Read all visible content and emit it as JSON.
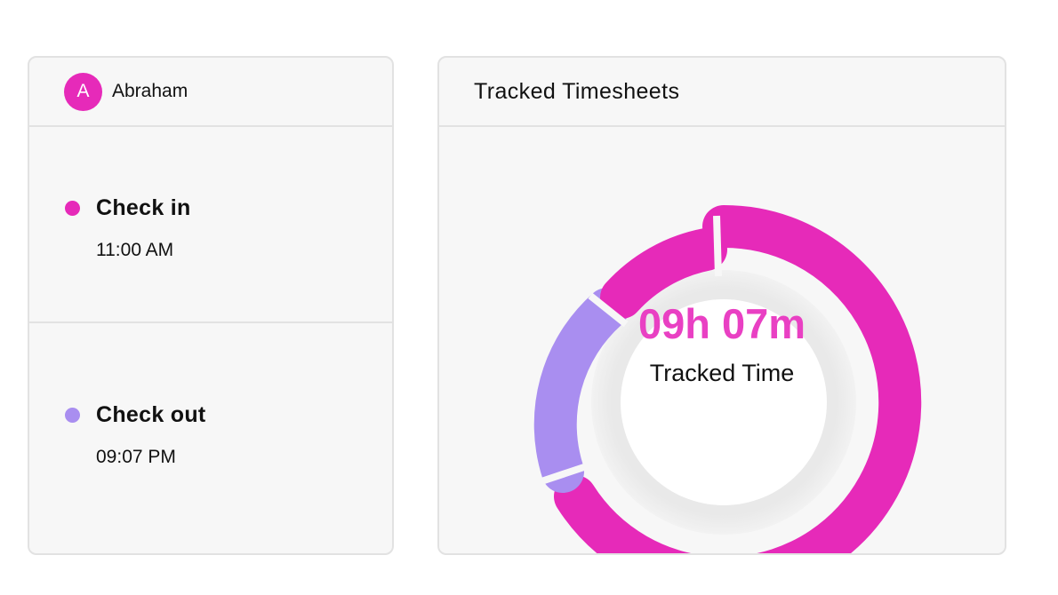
{
  "user": {
    "initial": "A",
    "name": "Abraham"
  },
  "events": [
    {
      "label": "Check in",
      "time": "11:00 AM",
      "color": "#e62ab9"
    },
    {
      "label": "Check out",
      "time": "09:07 PM",
      "color": "#a98ef0"
    }
  ],
  "timesheet": {
    "title": "Tracked Timesheets",
    "value": "09h 07m",
    "label": "Tracked Time",
    "value_color": "#e940c3"
  },
  "colors": {
    "accent": "#e62ab9",
    "secondary": "#a98ef0",
    "border": "#e2e2e2",
    "card_bg": "#f7f7f7"
  }
}
